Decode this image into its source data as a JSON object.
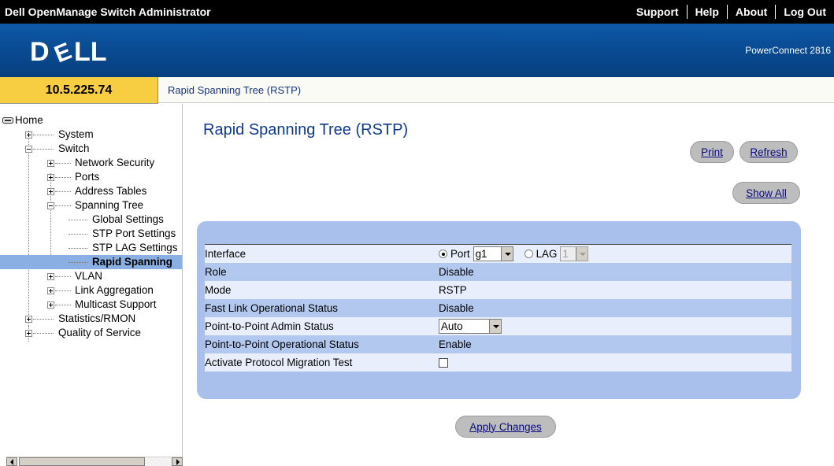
{
  "header": {
    "app_title": "Dell OpenManage Switch Administrator",
    "links": [
      "Support",
      "Help",
      "About",
      "Log Out"
    ],
    "brand": "DELL",
    "product": "PowerConnect 2816"
  },
  "ip": "10.5.225.74",
  "breadcrumb": "Rapid Spanning Tree (RSTP)",
  "tree": {
    "home": "Home",
    "system": "System",
    "switch": "Switch",
    "network_security": "Network Security",
    "ports": "Ports",
    "address_tables": "Address Tables",
    "spanning_tree": "Spanning Tree",
    "global_settings": "Global Settings",
    "stp_port_settings": "STP Port Settings",
    "stp_lag_settings": "STP LAG Settings",
    "rapid_spanning": "Rapid Spanning",
    "vlan": "VLAN",
    "link_aggregation": "Link Aggregation",
    "multicast_support": "Multicast Support",
    "statistics_rmon": "Statistics/RMON",
    "quality_of_service": "Quality of Service"
  },
  "main": {
    "title": "Rapid Spanning Tree (RSTP)",
    "buttons": {
      "print": "Print",
      "refresh": "Refresh",
      "show_all": "Show All",
      "apply": "Apply Changes"
    },
    "fields": {
      "interface": {
        "label": "Interface",
        "port_label": "Port",
        "port_value": "g1",
        "lag_label": "LAG",
        "lag_value": "1"
      },
      "role": {
        "label": "Role",
        "value": "Disable"
      },
      "mode": {
        "label": "Mode",
        "value": "RSTP"
      },
      "fast_link": {
        "label": "Fast Link Operational Status",
        "value": "Disable"
      },
      "p2p_admin": {
        "label": "Point-to-Point Admin Status",
        "value": "Auto"
      },
      "p2p_oper": {
        "label": "Point-to-Point Operational Status",
        "value": "Enable"
      },
      "migration": {
        "label": "Activate Protocol Migration Test",
        "checked": false
      }
    }
  },
  "colors": {
    "header_bg": "#000000",
    "brand_bg": "#0a4a92",
    "ip_bg": "#f7cd42",
    "panel_bg": "#a9c0ec",
    "selected_tree": "#8ab0e3"
  }
}
